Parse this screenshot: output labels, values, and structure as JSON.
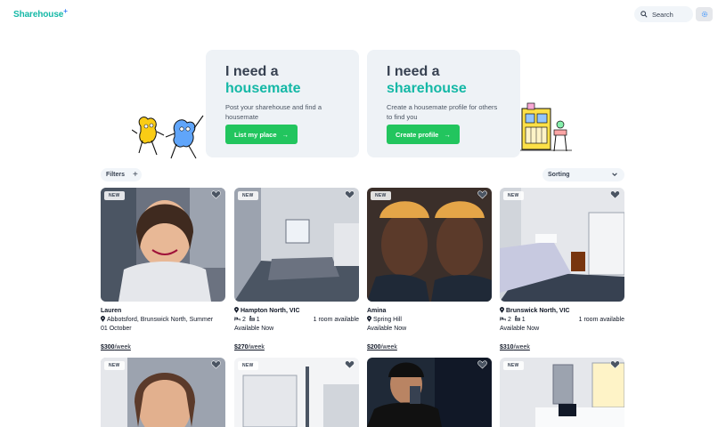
{
  "header": {
    "logo": "Sharehouse",
    "logo_mark": "+",
    "search_label": "Search",
    "settings_icon": "gear-icon"
  },
  "hero": [
    {
      "line1": "I need a",
      "line2": "housemate",
      "desc": "Post your sharehouse and find a housemate",
      "cta": "List my place",
      "cta_arrow": "→"
    },
    {
      "line1": "I need a",
      "line2": "sharehouse",
      "desc": "Create a housemate profile for others to find you",
      "cta": "Create profile",
      "cta_arrow": "→"
    }
  ],
  "filters": {
    "label": "Filters",
    "plus": "+"
  },
  "sorting": {
    "label": "Sorting"
  },
  "badge": "NEW",
  "colors": {
    "accent": "#14b8a6",
    "cta": "#22c55e",
    "hero_bg": "#eef2f6"
  },
  "listings": [
    {
      "name": "Lauren",
      "location": "Abbotsford, Brunswick North, Summer",
      "line3": "01 October",
      "price": "$300",
      "period": "/week"
    },
    {
      "location": "Hampton North, VIC",
      "beds": "2",
      "baths": "1",
      "rooms": "1 room available",
      "availability": "Available Now",
      "price": "$270",
      "period": "/week"
    },
    {
      "name": "Amina",
      "location": "Spring Hill",
      "availability": "Available Now",
      "price": "$200",
      "period": "/week"
    },
    {
      "location": "Brunswick North, VIC",
      "beds": "2",
      "baths": "1",
      "rooms": "1 room available",
      "availability": "Available Now",
      "price": "$310",
      "period": "/week"
    }
  ]
}
